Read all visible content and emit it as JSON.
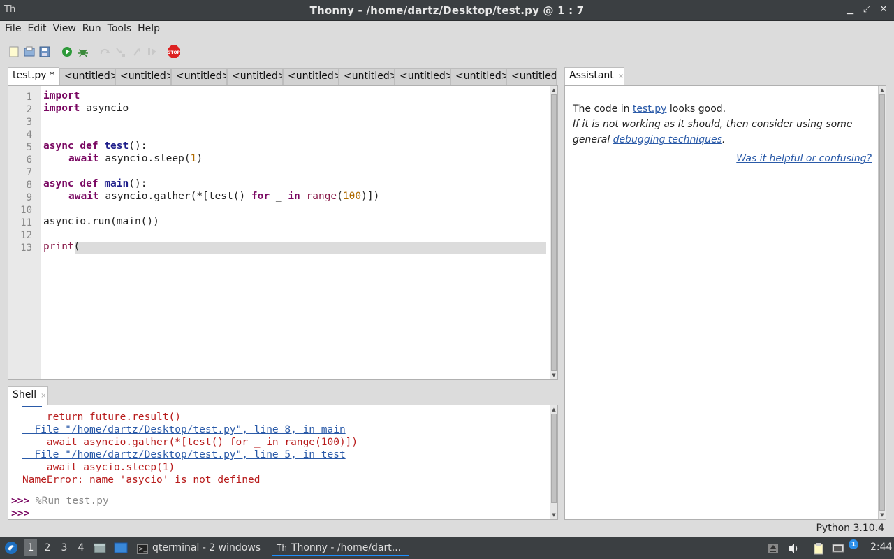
{
  "window": {
    "title": "Thonny  -  /home/dartz/Desktop/test.py  @  1 : 7",
    "icon_glyph": "Th",
    "controls": [
      "minimize",
      "maximize",
      "close"
    ]
  },
  "menu": [
    "File",
    "Edit",
    "View",
    "Run",
    "Tools",
    "Help"
  ],
  "toolbar": {
    "buttons": [
      {
        "name": "new-file-icon"
      },
      {
        "name": "open-file-icon"
      },
      {
        "name": "save-file-icon"
      },
      {
        "name": "run-icon"
      },
      {
        "name": "debug-icon"
      },
      {
        "name": "step-over-icon"
      },
      {
        "name": "step-into-icon"
      },
      {
        "name": "step-out-icon"
      },
      {
        "name": "resume-icon"
      },
      {
        "name": "stop-icon",
        "label": "STOP"
      }
    ]
  },
  "editor": {
    "tabs": [
      {
        "label": "test.py *",
        "active": true
      },
      {
        "label": "<untitled>"
      },
      {
        "label": "<untitled>"
      },
      {
        "label": "<untitled>"
      },
      {
        "label": "<untitled>"
      },
      {
        "label": "<untitled>"
      },
      {
        "label": "<untitled>"
      },
      {
        "label": "<untitled>"
      },
      {
        "label": "<untitled>"
      },
      {
        "label": "<untitled>"
      }
    ],
    "line_numbers": [
      "1",
      "2",
      "3",
      "4",
      "5",
      "6",
      "7",
      "8",
      "9",
      "10",
      "11",
      "12",
      "13"
    ],
    "lines": {
      "l1_kw": "import",
      "l2_kw": "import",
      "l2_rest": " asyncio",
      "l5_kw": "async def",
      "l5_fn": "test",
      "l5_rest": "():",
      "l6_kw": "await",
      "l6_a": " asyncio.sleep(",
      "l6_num": "1",
      "l6_b": ")",
      "l8_kw": "async def",
      "l8_fn": "main",
      "l8_rest": "():",
      "l9_kw": "await",
      "l9_a": " asyncio.gather(*[test() ",
      "l9_kw2": "for",
      "l9_b": " _ ",
      "l9_kw3": "in",
      "l9_c": " ",
      "l9_bi": "range",
      "l9_d": "(",
      "l9_num": "100",
      "l9_e": ")])",
      "l11": "asyncio.run(main())",
      "l13_bi": "print",
      "l13_rest": "("
    }
  },
  "shell": {
    "tab_label": "Shell",
    "lines": [
      "    return future.result()",
      "  File \"/home/dartz/Desktop/test.py\", line 8, in main",
      "    await asyncio.gather(*[test() for _ in range(100)])",
      "  File \"/home/dartz/Desktop/test.py\", line 5, in test",
      "    await asycio.sleep(1)",
      "NameError: name 'asycio' is not defined"
    ],
    "prompt": ">>>",
    "command": "%Run test.py"
  },
  "assistant": {
    "tab_label": "Assistant",
    "text_before": "The code in ",
    "file_link": "test.py",
    "text_after": " looks good.",
    "italic_text": "If it is not working as it should, then consider using some general ",
    "debug_link": "debugging techniques",
    "italic_end": ".",
    "feedback_link": "Was it helpful or confusing?"
  },
  "status": {
    "python_version": "Python 3.10.4"
  },
  "taskbar": {
    "workspaces": [
      "1",
      "2",
      "3",
      "4"
    ],
    "tasks": [
      {
        "label": "qterminal - 2 windows"
      },
      {
        "label": "Thonny  -  /home/dart...",
        "active": true
      }
    ],
    "clock": "2:44",
    "notification_count": "1"
  },
  "colors": {
    "keyword": "#7a0862",
    "function": "#1d1d8a",
    "number": "#b06a00",
    "error": "#b81c1c",
    "link": "#2a5aa8",
    "titlebar": "#3b3f42"
  }
}
